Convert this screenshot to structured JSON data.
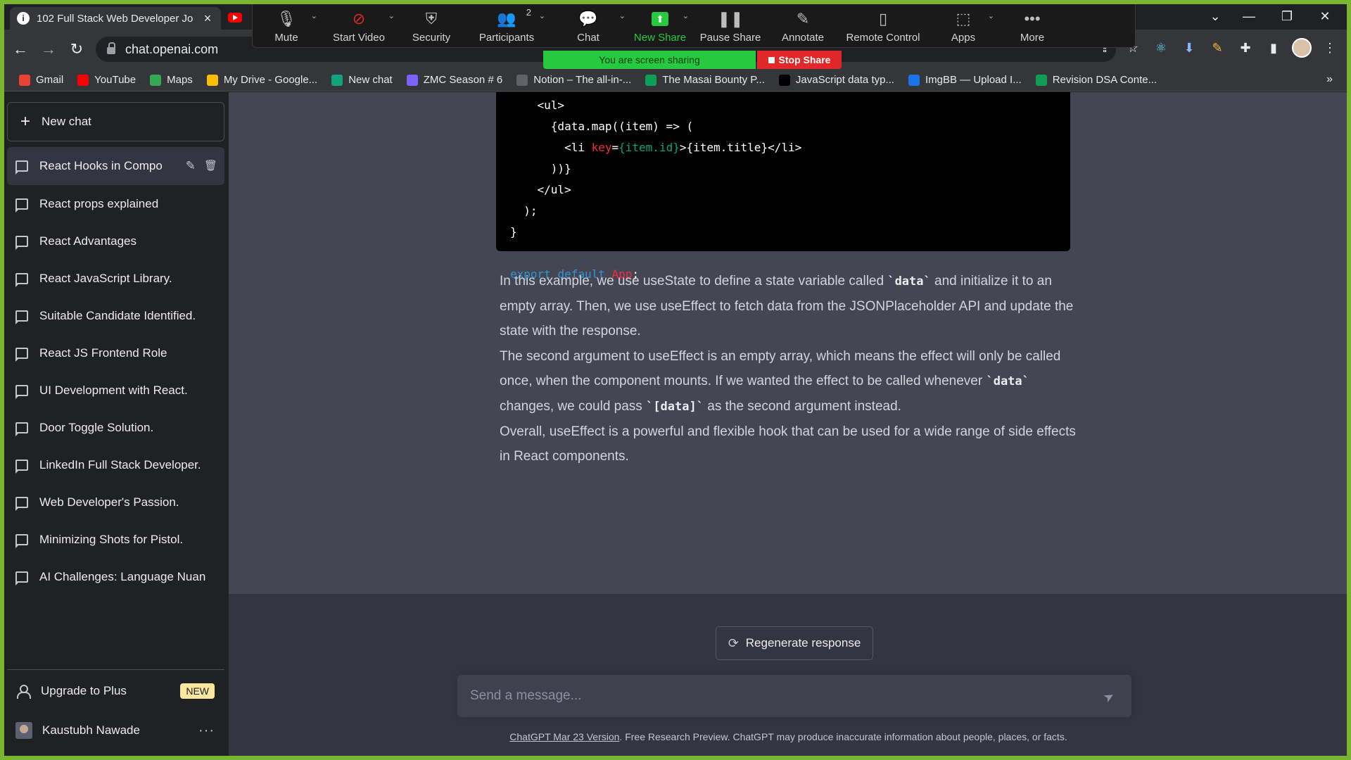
{
  "browser": {
    "tab_title": "102 Full Stack Web Developer Jo",
    "tab_favicon": "i",
    "url": "chat.openai.com",
    "bookmarks": [
      {
        "label": "Gmail",
        "icon": "gmail-icon",
        "color": "#ea4335"
      },
      {
        "label": "YouTube",
        "icon": "youtube-icon",
        "color": "#ff0000"
      },
      {
        "label": "Maps",
        "icon": "maps-icon",
        "color": "#34a853"
      },
      {
        "label": "My Drive - Google...",
        "icon": "drive-icon",
        "color": "#fbbc04"
      },
      {
        "label": "New chat",
        "icon": "openai-icon",
        "color": "#10a37f"
      },
      {
        "label": "ZMC Season # 6",
        "icon": "list-icon",
        "color": "#7b61ff"
      },
      {
        "label": "Notion – The all-in-...",
        "icon": "notion-icon",
        "color": "#5f6368"
      },
      {
        "label": "The Masai Bounty P...",
        "icon": "plus-icon",
        "color": "#0f9d58"
      },
      {
        "label": "JavaScript data typ...",
        "icon": "m-icon",
        "color": "#000000"
      },
      {
        "label": "ImgBB — Upload I...",
        "icon": "ibb-icon",
        "color": "#1a73e8"
      },
      {
        "label": "Revision DSA Conte...",
        "icon": "plus-icon",
        "color": "#0f9d58"
      }
    ]
  },
  "zoom": {
    "buttons": [
      {
        "label": "Mute",
        "icon": "microphone-icon",
        "caret": true
      },
      {
        "label": "Start Video",
        "icon": "video-off-icon",
        "caret": true
      },
      {
        "label": "Security",
        "icon": "shield-icon",
        "caret": false
      },
      {
        "label": "Participants",
        "icon": "participants-icon",
        "caret": true,
        "count": "2"
      },
      {
        "label": "Chat",
        "icon": "chat-bubble-icon",
        "caret": true
      },
      {
        "label": "New Share",
        "icon": "share-arrow-icon",
        "caret": true
      },
      {
        "label": "Pause Share",
        "icon": "pause-icon",
        "caret": false
      },
      {
        "label": "Annotate",
        "icon": "pencil-icon",
        "caret": false
      },
      {
        "label": "Remote Control",
        "icon": "mouse-icon",
        "caret": false
      },
      {
        "label": "Apps",
        "icon": "apps-icon",
        "caret": true
      },
      {
        "label": "More",
        "icon": "more-dots-icon",
        "caret": false
      }
    ],
    "sharing_banner": "You are screen sharing",
    "stop_share": "Stop Share",
    "accent_green": "#27c93f",
    "stop_red": "#e02828"
  },
  "sidebar": {
    "new_chat": "New chat",
    "conversations": [
      "React Hooks in Compo",
      "React props explained",
      "React Advantages",
      "React JavaScript Library.",
      "Suitable Candidate Identified.",
      "React JS Frontend Role",
      "UI Development with React.",
      "Door Toggle Solution.",
      "LinkedIn Full Stack Developer.",
      "Web Developer's Passion.",
      "Minimizing Shots for Pistol.",
      "AI Challenges: Language Nuan"
    ],
    "upgrade": "Upgrade to Plus",
    "upgrade_badge": "NEW",
    "user_name": "Kaustubh Nawade"
  },
  "main": {
    "code_lines": {
      "l1": "    <ul>",
      "l2a": "      {data.map((item) => (",
      "l3_open": "        <li ",
      "l3_attr": "key",
      "l3_eq": "=",
      "l3_val": "{item.id}",
      "l3_rest": ">{item.title}</li>",
      "l4": "      ))}",
      "l5": "    </ul>",
      "l6": "  );",
      "l7": "}",
      "l8_kw1": "export",
      "l8_kw2": "default",
      "l8_fn": "App",
      "l8_end": ";"
    },
    "p1_a": "In this example, we use useState to define a state variable called ",
    "p1_code": "`data`",
    "p1_b": " and initialize it to an empty array. Then, we use useEffect to fetch data from the JSONPlaceholder API and update the state with the response.",
    "p2_a": "The second argument to useEffect is an empty array, which means the effect will only be called once, when the component mounts. If we wanted the effect to be called whenever ",
    "p2_code1": "`data`",
    "p2_b": " changes, we could pass ",
    "p2_code2": "`[data]`",
    "p2_c": " as the second argument instead.",
    "p3": "Overall, useEffect is a powerful and flexible hook that can be used for a wide range of side effects in React components.",
    "regenerate": "Regenerate response",
    "message_placeholder": "Send a message...",
    "footer_link": "ChatGPT Mar 23 Version",
    "footer_text": ". Free Research Preview. ChatGPT may produce inaccurate information about people, places, or facts."
  }
}
